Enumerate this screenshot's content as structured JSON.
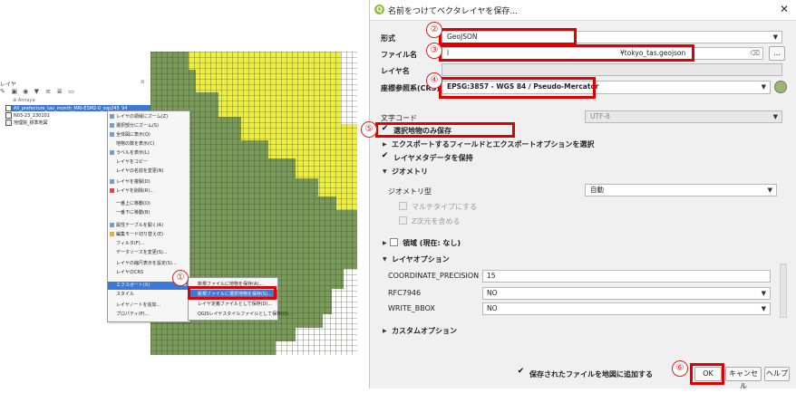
{
  "layers_panel": {
    "title": "レイヤ",
    "close_label": "☒",
    "toolbar_icons": [
      "open-layer-style-icon",
      "add-group-icon",
      "manage-map-themes-icon",
      "filter-legend-icon",
      "expand-all-icon",
      "collapse-all-icon",
      "remove-layer-icon"
    ],
    "items": [
      {
        "label": "Annaya",
        "type": "group-header"
      },
      {
        "label": "All_prefecture_tav_month_MRI-ESM2-0_ssp245_94",
        "checked": true,
        "selected": true
      },
      {
        "label": "N03-23_230101",
        "checked": true,
        "selected": false
      },
      {
        "label": "地理院_標準地図",
        "checked": false,
        "selected": false
      }
    ]
  },
  "raster_colors": {
    "green": "#7a9a5a",
    "yellow": "#eeee44",
    "grid": "#2a3a22"
  },
  "context_menu": {
    "items": [
      "レイヤの領域にズーム(Z)",
      "選択部分にズーム(S)",
      "全体図に表示(Q)",
      "地物の数を表示(C)",
      "ラベルを表示(L)",
      "レイヤをコピー",
      "レイヤの名前を変更(N)",
      "レイヤを複製(D)",
      "レイヤを削除(R)...",
      "一番上に移動(O)",
      "一番下に移動(B)",
      "属性テーブルを開く(A)",
      "編集モード切り替え(E)",
      "フィルタ(F)...",
      "データソースを変更(S)...",
      "レイヤの縮尺表示を設定(S)...",
      "レイヤのCRS",
      "エクスポート(X)",
      "スタイル",
      "レイヤノートを追加...",
      "プロパティ(P)..."
    ],
    "highlighted_index": 17
  },
  "sub_menu": {
    "items": [
      "新規ファイルに地物を保存(A)...",
      "新規ファイルに選択地物を保存(S)...",
      "レイヤ定義ファイルとして保存(D)...",
      "QGISレイヤスタイルファイルとして保存(Q)..."
    ],
    "highlighted_index": 1
  },
  "callouts": [
    "①",
    "②",
    "③",
    "④",
    "⑤",
    "⑥"
  ],
  "dialog": {
    "title": "名前をつけてベクタレイヤを保存...",
    "close": "✕",
    "format_label": "形式",
    "format_value": "GeoJSON",
    "filename_label": "ファイル名",
    "filename_value": "¥tokyo_tas.geojson",
    "filename_prefix": "l",
    "browse_label": "...",
    "layername_label": "レイヤ名",
    "crs_label": "座標参照系(CRS)",
    "crs_value": "EPSG:3857 - WGS 84 / Pseudo-Mercator",
    "encoding_label": "文字コード",
    "encoding_value": "UTF-8",
    "selected_only_label": "選択地物のみ保存",
    "selected_only_checked": true,
    "export_fields_label": "エクスポートするフィールドとエクスポートオプションを選択",
    "persist_metadata_label": "レイヤメタデータを保持",
    "persist_metadata_checked": true,
    "geometry_section": "ジオメトリ",
    "geometry_type_label": "ジオメトリ型",
    "geometry_type_value": "自動",
    "multi_type_label": "マルチタイプにする",
    "z_dim_label": "Z次元を含める",
    "extent_label": "領域 (現在: なし)",
    "layer_options_section": "レイヤオプション",
    "layer_options": [
      {
        "name": "COORDINATE_PRECISION",
        "value": "15"
      },
      {
        "name": "RFC7946",
        "value": "NO"
      },
      {
        "name": "WRITE_BBOX",
        "value": "NO"
      }
    ],
    "custom_options_section": "カスタムオプション",
    "add_to_map_label": "保存されたファイルを地図に追加する",
    "add_to_map_checked": true,
    "ok_label": "OK",
    "cancel_label": "キャンセル",
    "help_label": "ヘルプ"
  }
}
